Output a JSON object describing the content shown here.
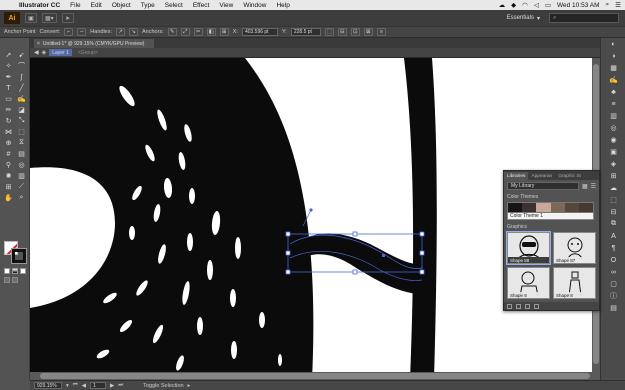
{
  "menubar": {
    "items": [
      "Illustrator CC",
      "File",
      "Edit",
      "Object",
      "Type",
      "Select",
      "Effect",
      "View",
      "Window",
      "Help"
    ],
    "clock": "Wed 10:53 AM"
  },
  "appbar": {
    "badge": "Ai",
    "workspace": "Essentials",
    "workspace_chevron": "▾"
  },
  "controlbar": {
    "mode_label": "Anchor Point",
    "convert_label": "Convert:",
    "handles_label": "Handles:",
    "anchors_label": "Anchors:",
    "x_label": "X:",
    "x_value": "403.596 pt",
    "y_label": "Y:",
    "y_value": "228.5 pt"
  },
  "document": {
    "tab_title": "Untitled-1* @ 929.15% (CMYK/GPU Preview)",
    "layer_name": "Layer 1",
    "group_name": "<Group>"
  },
  "libraries_panel": {
    "tabs": [
      "Libraries",
      "Appearan",
      "Graphic St"
    ],
    "library_select": "My Library",
    "color_themes_heading": "Color Themes",
    "theme_colors": [
      "#151515",
      "#3b3130",
      "#c9a89a",
      "#7e6757",
      "#55473c",
      "#46392f"
    ],
    "theme_name": "Color Theme 1",
    "graphics_heading": "Graphics",
    "graphics": [
      {
        "caption": "Shape 88"
      },
      {
        "caption": "Shape 87"
      },
      {
        "caption": "Shape 8"
      },
      {
        "caption": "Shape 8"
      }
    ]
  },
  "statusbar": {
    "zoom": "929.15%",
    "artboard": "1",
    "tool_status": "Toggle Selection"
  },
  "colors": {
    "artwork": "#0b0b0b",
    "selection": "#4a67d8"
  }
}
